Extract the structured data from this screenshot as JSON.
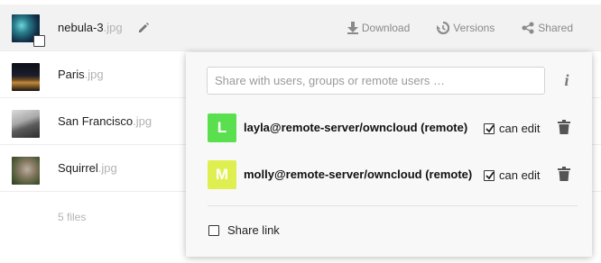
{
  "files": [
    {
      "base": "nebula-3",
      "ext": ".jpg"
    },
    {
      "base": "Paris",
      "ext": ".jpg"
    },
    {
      "base": "San Francisco",
      "ext": ".jpg"
    },
    {
      "base": "Squirrel",
      "ext": ".jpg"
    }
  ],
  "actions": {
    "download": "Download",
    "versions": "Versions",
    "shared": "Shared"
  },
  "footer": {
    "count": "5 files"
  },
  "share": {
    "placeholder": "Share with users, groups or remote users …",
    "info_icon": "i",
    "entries": [
      {
        "initial": "L",
        "recipient": "layla@remote-server/owncloud (remote)",
        "permission": "can edit",
        "checked": true,
        "color": "#5ae04f"
      },
      {
        "initial": "M",
        "recipient": "molly@remote-server/owncloud (remote)",
        "permission": "can edit",
        "checked": true,
        "color": "#dfef4f"
      }
    ],
    "share_link_label": "Share link"
  },
  "colors": {
    "selected_row": "#f2f2f2",
    "panel_bg": "#f8f8f8",
    "muted_text": "#8a8a8a",
    "extension_text": "#b3b3b3"
  }
}
